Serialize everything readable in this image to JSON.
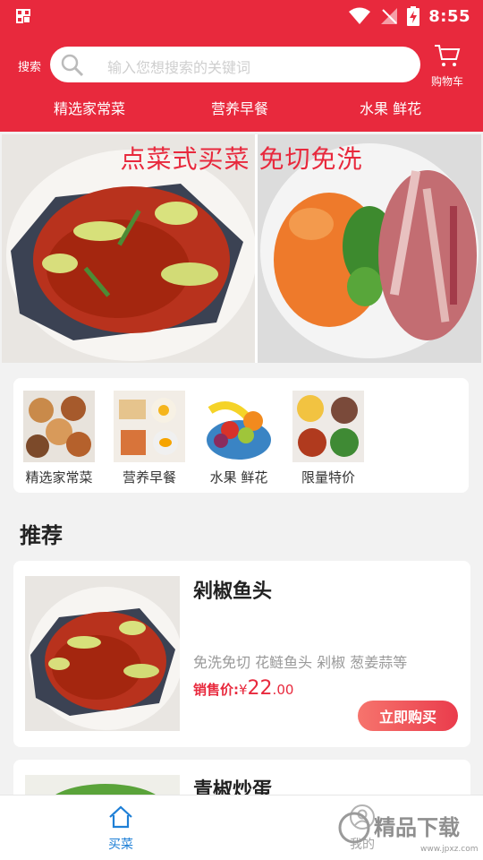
{
  "status_bar": {
    "time": "8:55"
  },
  "header": {
    "search_label": "搜索",
    "search_placeholder": "输入您想搜索的关键词",
    "cart_label": "购物车",
    "categories": [
      "精选家常菜",
      "营养早餐",
      "水果 鲜花"
    ]
  },
  "banner": {
    "caption": "点菜式买菜 免切免洗"
  },
  "category_grid": [
    {
      "label": "精选家常菜"
    },
    {
      "label": "营养早餐"
    },
    {
      "label": "水果 鲜花"
    },
    {
      "label": "限量特价"
    }
  ],
  "section": {
    "title": "推荐"
  },
  "products": [
    {
      "name": "剁椒鱼头",
      "desc": "免洗免切 花鲢鱼头 剁椒 葱姜蒜等",
      "price_label": "销售价:",
      "currency": "¥",
      "price_int": "22",
      "price_dec": ".00",
      "buy_label": "立即购买"
    },
    {
      "name": "青椒炒蛋"
    }
  ],
  "tabbar": {
    "items": [
      {
        "label": "买菜"
      },
      {
        "label": "我的"
      }
    ]
  },
  "watermark": {
    "text": "精品下载",
    "subtext": "www.jpxz.com"
  },
  "colors": {
    "brand": "#e8293d",
    "active_tab": "#1e7fd6",
    "price": "#e8293d"
  }
}
